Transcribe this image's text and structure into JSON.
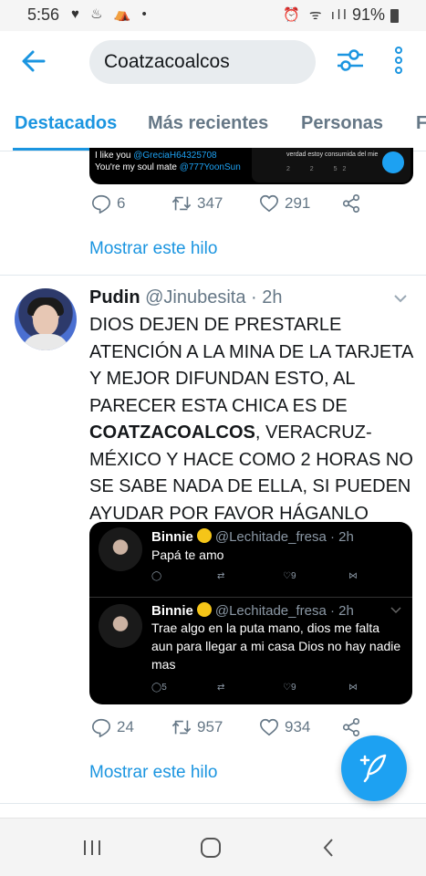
{
  "status_bar": {
    "time": "5:56",
    "battery": "91%"
  },
  "search": {
    "query": "Coatzacoalcos"
  },
  "tabs": [
    {
      "label": "Destacados"
    },
    {
      "label": "Más recientes"
    },
    {
      "label": "Personas"
    },
    {
      "label": "F"
    }
  ],
  "tweet1": {
    "media_lines": [
      "I like you",
      "@GreciaH64325708",
      "You're my soul mate",
      "@777YoonSun"
    ],
    "media_right_text": "verdad estoy consumida del mie",
    "media_right_counts": [
      "2",
      "2",
      "52"
    ],
    "reply_count": "6",
    "retweet_count": "347",
    "like_count": "291",
    "show_thread": "Mostrar este hilo"
  },
  "tweet2": {
    "name": "Pudin",
    "handle": "@Jinubesita",
    "time": "· 2h",
    "text_before": "DIOS DEJEN DE PRESTARLE ATENCIÓN A LA MINA DE LA TARJETA Y MEJOR DIFUNDAN ESTO, AL PARECER ESTA CHICA ES DE ",
    "text_bold": "COATZACOALCOS",
    "text_after": ", VERACRUZ-MÉXICO Y HACE COMO 2 HORAS NO SE SABE NADA DE ELLA, SI PUEDEN AYUDAR POR FAVOR HÁGANLO",
    "embedded": [
      {
        "name": "Binnie",
        "handle": "@Lechitade_fresa · 2h",
        "text": "Papá te amo",
        "reply": "",
        "retweet": "",
        "like": "9"
      },
      {
        "name": "Binnie",
        "handle": "@Lechitade_fresa · 2h",
        "text": "Trae algo en la puta mano, dios me falta aun para llegar a mi casa Dios no hay nadie mas",
        "reply": "5",
        "retweet": "",
        "like": "9"
      }
    ],
    "reply_count": "24",
    "retweet_count": "957",
    "like_count": "934",
    "show_thread": "Mostrar este hilo"
  }
}
